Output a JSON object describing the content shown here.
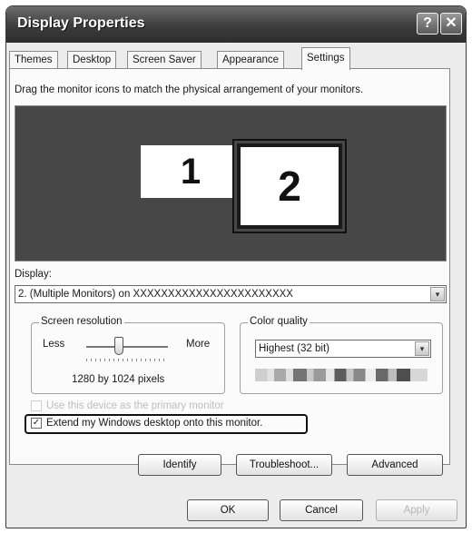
{
  "window": {
    "title": "Display Properties",
    "help_glyph": "?",
    "close_glyph": "✕"
  },
  "tabs": [
    {
      "label": "Themes"
    },
    {
      "label": "Desktop"
    },
    {
      "label": "Screen Saver"
    },
    {
      "label": "Appearance"
    },
    {
      "label": "Settings"
    }
  ],
  "settings": {
    "instruction": "Drag the monitor icons to match the physical arrangement of your monitors.",
    "monitors": [
      {
        "label": "1"
      },
      {
        "label": "2"
      }
    ],
    "display_label": "Display:",
    "display_value": "2. (Multiple Monitors) on   XXXXXXXXXXXXXXXXXXXXXXX",
    "screen_resolution": {
      "legend": "Screen resolution",
      "less_label": "Less",
      "more_label": "More",
      "value_text": "1280 by 1024 pixels",
      "slider_fraction": 0.4
    },
    "color_quality": {
      "legend": "Color quality",
      "value": "Highest (32 bit)"
    },
    "primary_checkbox_label": "Use this device as the primary monitor",
    "extend_checkbox_label": "Extend my Windows desktop onto this monitor.",
    "extend_checked": true,
    "buttons": {
      "identify": "Identify",
      "troubleshoot": "Troubleshoot...",
      "advanced": "Advanced"
    }
  },
  "footer": {
    "ok": "OK",
    "cancel": "Cancel",
    "apply": "Apply"
  },
  "icons": {
    "dropdown_arrow": "▾",
    "check_mark": "✓"
  }
}
